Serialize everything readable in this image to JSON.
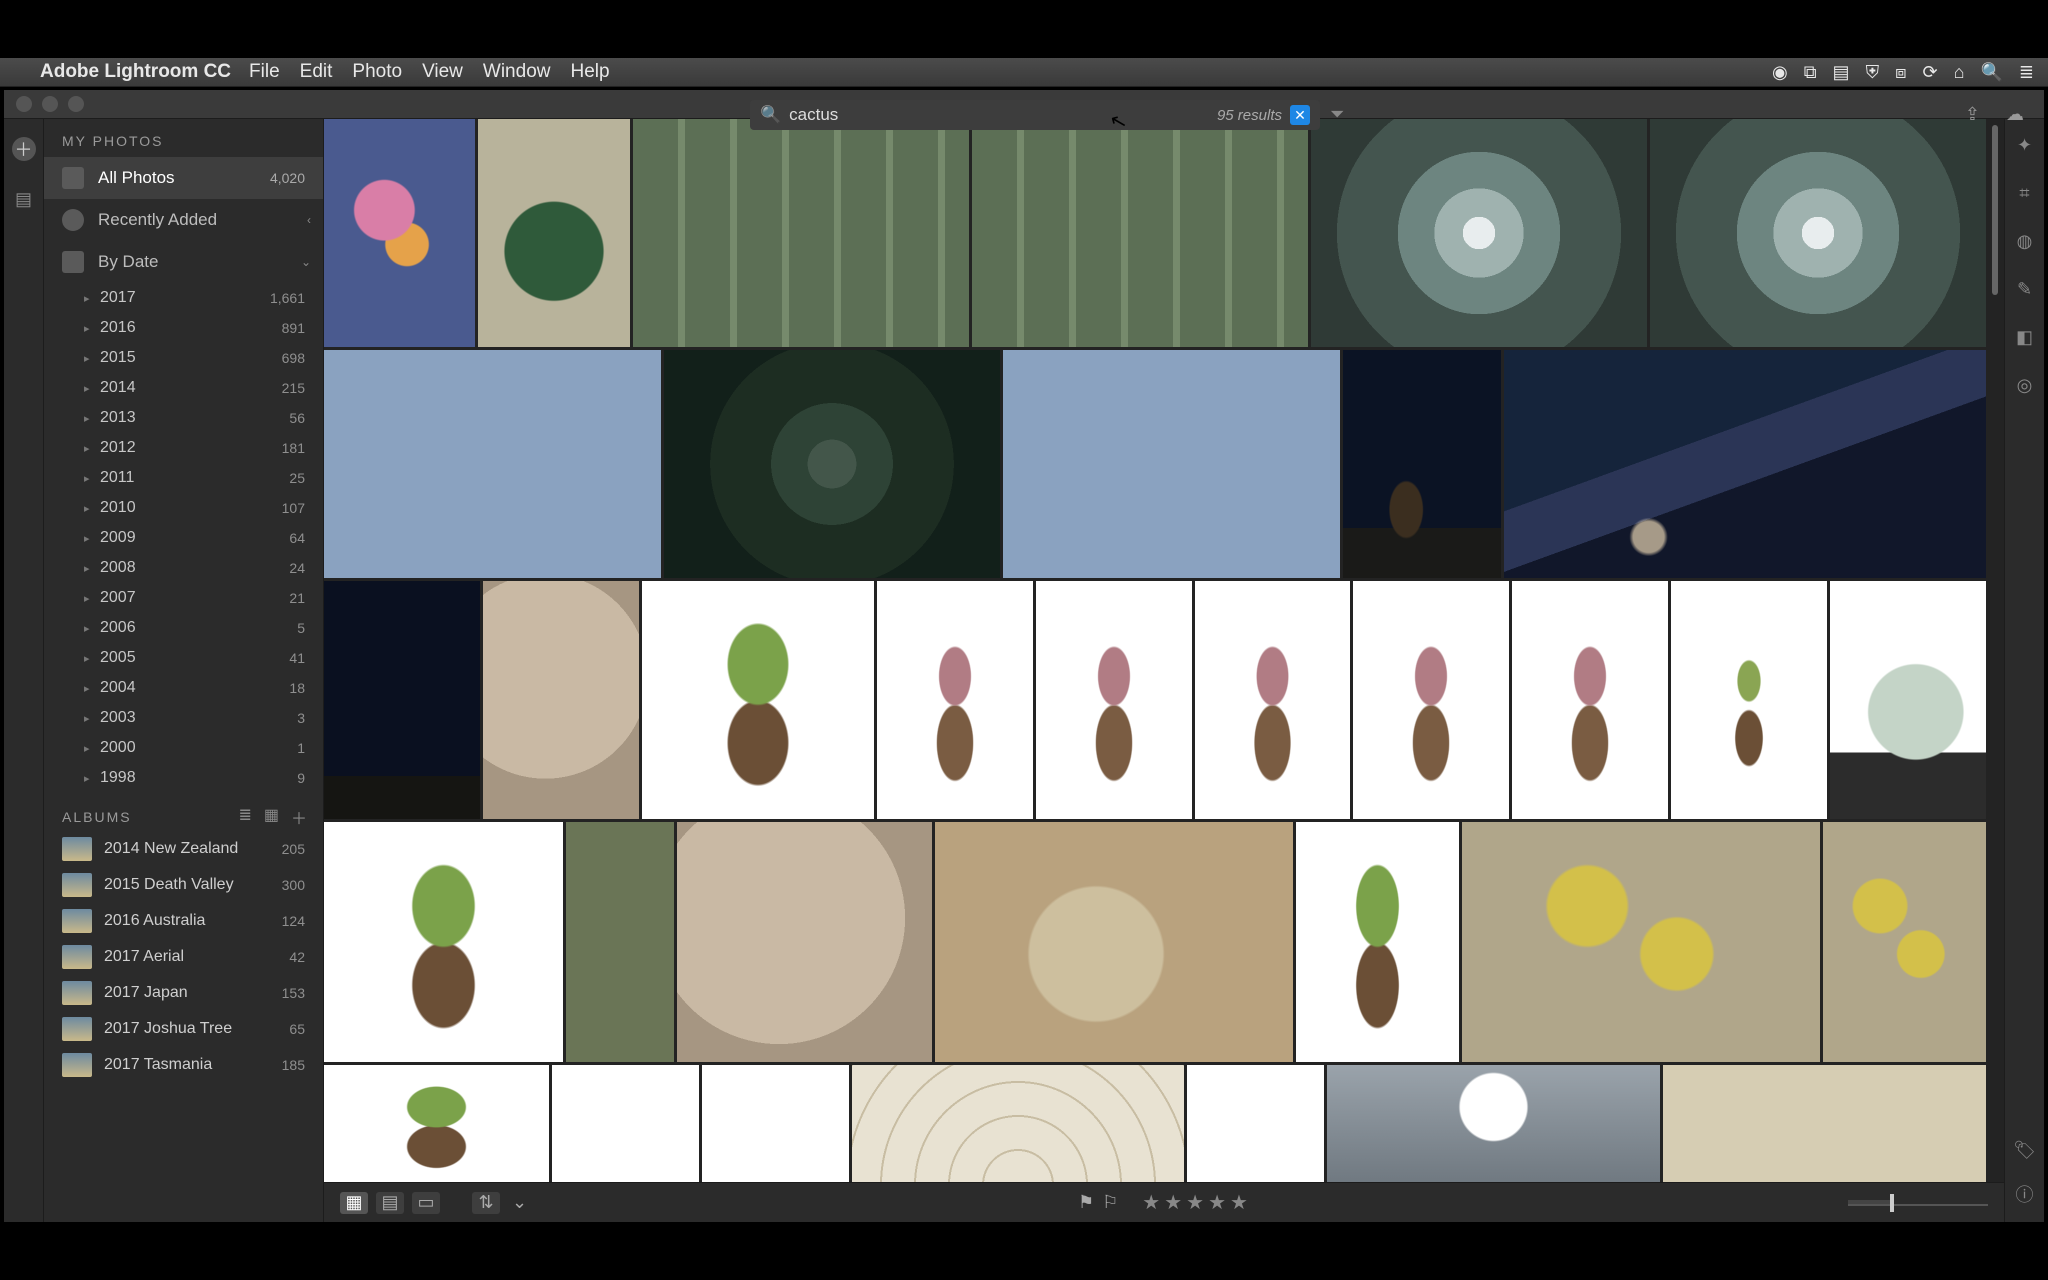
{
  "menubar": {
    "app": "Adobe Lightroom CC",
    "items": [
      "File",
      "Edit",
      "Photo",
      "View",
      "Window",
      "Help"
    ]
  },
  "search": {
    "query": "cactus",
    "results_label": "95 results"
  },
  "sidebar": {
    "section_title": "MY PHOTOS",
    "all_photos_label": "All Photos",
    "all_photos_count": "4,020",
    "recently_added_label": "Recently Added",
    "by_date_label": "By Date",
    "years": [
      {
        "y": "2017",
        "c": "1,661"
      },
      {
        "y": "2016",
        "c": "891"
      },
      {
        "y": "2015",
        "c": "698"
      },
      {
        "y": "2014",
        "c": "215"
      },
      {
        "y": "2013",
        "c": "56"
      },
      {
        "y": "2012",
        "c": "181"
      },
      {
        "y": "2011",
        "c": "25"
      },
      {
        "y": "2010",
        "c": "107"
      },
      {
        "y": "2009",
        "c": "64"
      },
      {
        "y": "2008",
        "c": "24"
      },
      {
        "y": "2007",
        "c": "21"
      },
      {
        "y": "2006",
        "c": "5"
      },
      {
        "y": "2005",
        "c": "41"
      },
      {
        "y": "2004",
        "c": "18"
      },
      {
        "y": "2003",
        "c": "3"
      },
      {
        "y": "2000",
        "c": "1"
      },
      {
        "y": "1998",
        "c": "9"
      }
    ],
    "albums_title": "ALBUMS",
    "albums": [
      {
        "name": "2014 New Zealand",
        "c": "205"
      },
      {
        "name": "2015 Death Valley",
        "c": "300"
      },
      {
        "name": "2016 Australia",
        "c": "124"
      },
      {
        "name": "2017 Aerial",
        "c": "42"
      },
      {
        "name": "2017 Japan",
        "c": "153"
      },
      {
        "name": "2017 Joshua Tree",
        "c": "65"
      },
      {
        "name": "2017 Tasmania",
        "c": "185"
      }
    ]
  },
  "footer": {
    "stars": "★★★★★"
  }
}
